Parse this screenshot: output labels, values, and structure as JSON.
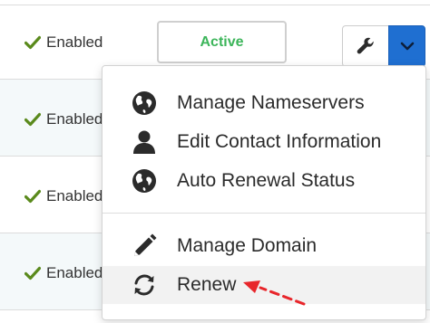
{
  "rows": [
    {
      "status": "Enabled"
    },
    {
      "status": "Enabled"
    },
    {
      "status": "Enabled"
    },
    {
      "status": "Enabled"
    }
  ],
  "active_button": {
    "label": "Active",
    "color": "#3cb55a"
  },
  "actions": {
    "tool_icon": "wrench-icon",
    "dropdown_icon": "chevron-down-icon",
    "dropdown_color": "#1f6fd1"
  },
  "menu": {
    "items": [
      {
        "label": "Manage Nameservers",
        "icon": "globe-icon"
      },
      {
        "label": "Edit Contact Information",
        "icon": "user-icon"
      },
      {
        "label": "Auto Renewal Status",
        "icon": "globe-icon"
      },
      {
        "label": "Manage Domain",
        "icon": "pencil-icon"
      },
      {
        "label": "Renew",
        "icon": "refresh-icon",
        "highlighted": true
      }
    ]
  },
  "annotation": {
    "arrow_color": "#e8262b"
  }
}
